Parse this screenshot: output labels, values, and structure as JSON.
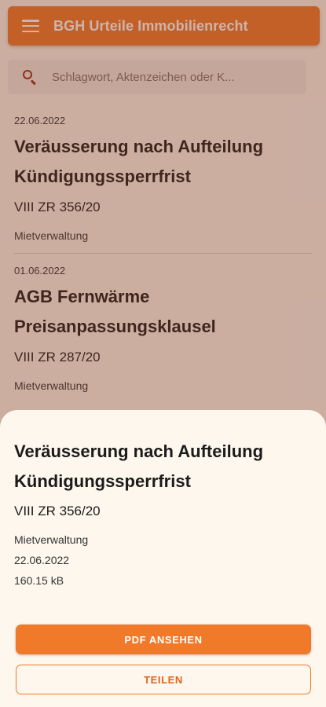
{
  "app_bar": {
    "title": "BGH Urteile Immobilienrecht",
    "menu_icon": "hamburger-menu-icon"
  },
  "search": {
    "placeholder": "Schlagwort, Aktenzeichen oder K...",
    "icon": "search-icon"
  },
  "list": [
    {
      "date": "22.06.2022",
      "title_line1": "Veräusserung nach Aufteilung",
      "title_line2": "Kündigungssperrfrist",
      "az": "VIII ZR 356/20",
      "category": "Mietverwaltung"
    },
    {
      "date": "01.06.2022",
      "title_line1": "AGB Fernwärme",
      "title_line2": "Preisanpassungsklausel",
      "az": "VIII ZR 287/20",
      "category": "Mietverwaltung"
    }
  ],
  "sheet": {
    "title_line1": "Veräusserung nach Aufteilung",
    "title_line2": "Kündigungssperrfrist",
    "az": "VIII ZR 356/20",
    "category": "Mietverwaltung",
    "date": "22.06.2022",
    "size": "160.15 kB",
    "pdf_button": "PDF ANSEHEN",
    "share_button": "TEILEN"
  },
  "colors": {
    "accent": "#f07a2a",
    "background": "#fdf7ee",
    "scrim": "#7a3a24"
  }
}
